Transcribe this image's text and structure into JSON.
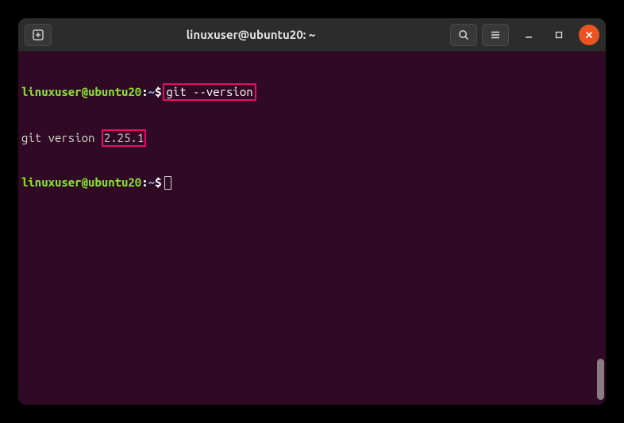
{
  "titlebar": {
    "title": "linuxuser@ubuntu20: ~"
  },
  "terminal": {
    "prompt": {
      "user_host": "linuxuser@ubuntu20",
      "separator": ":",
      "path": "~",
      "symbol": "$"
    },
    "line1": {
      "command": "git --version"
    },
    "line2": {
      "output_prefix": "git version ",
      "version": "2.25.1"
    }
  }
}
